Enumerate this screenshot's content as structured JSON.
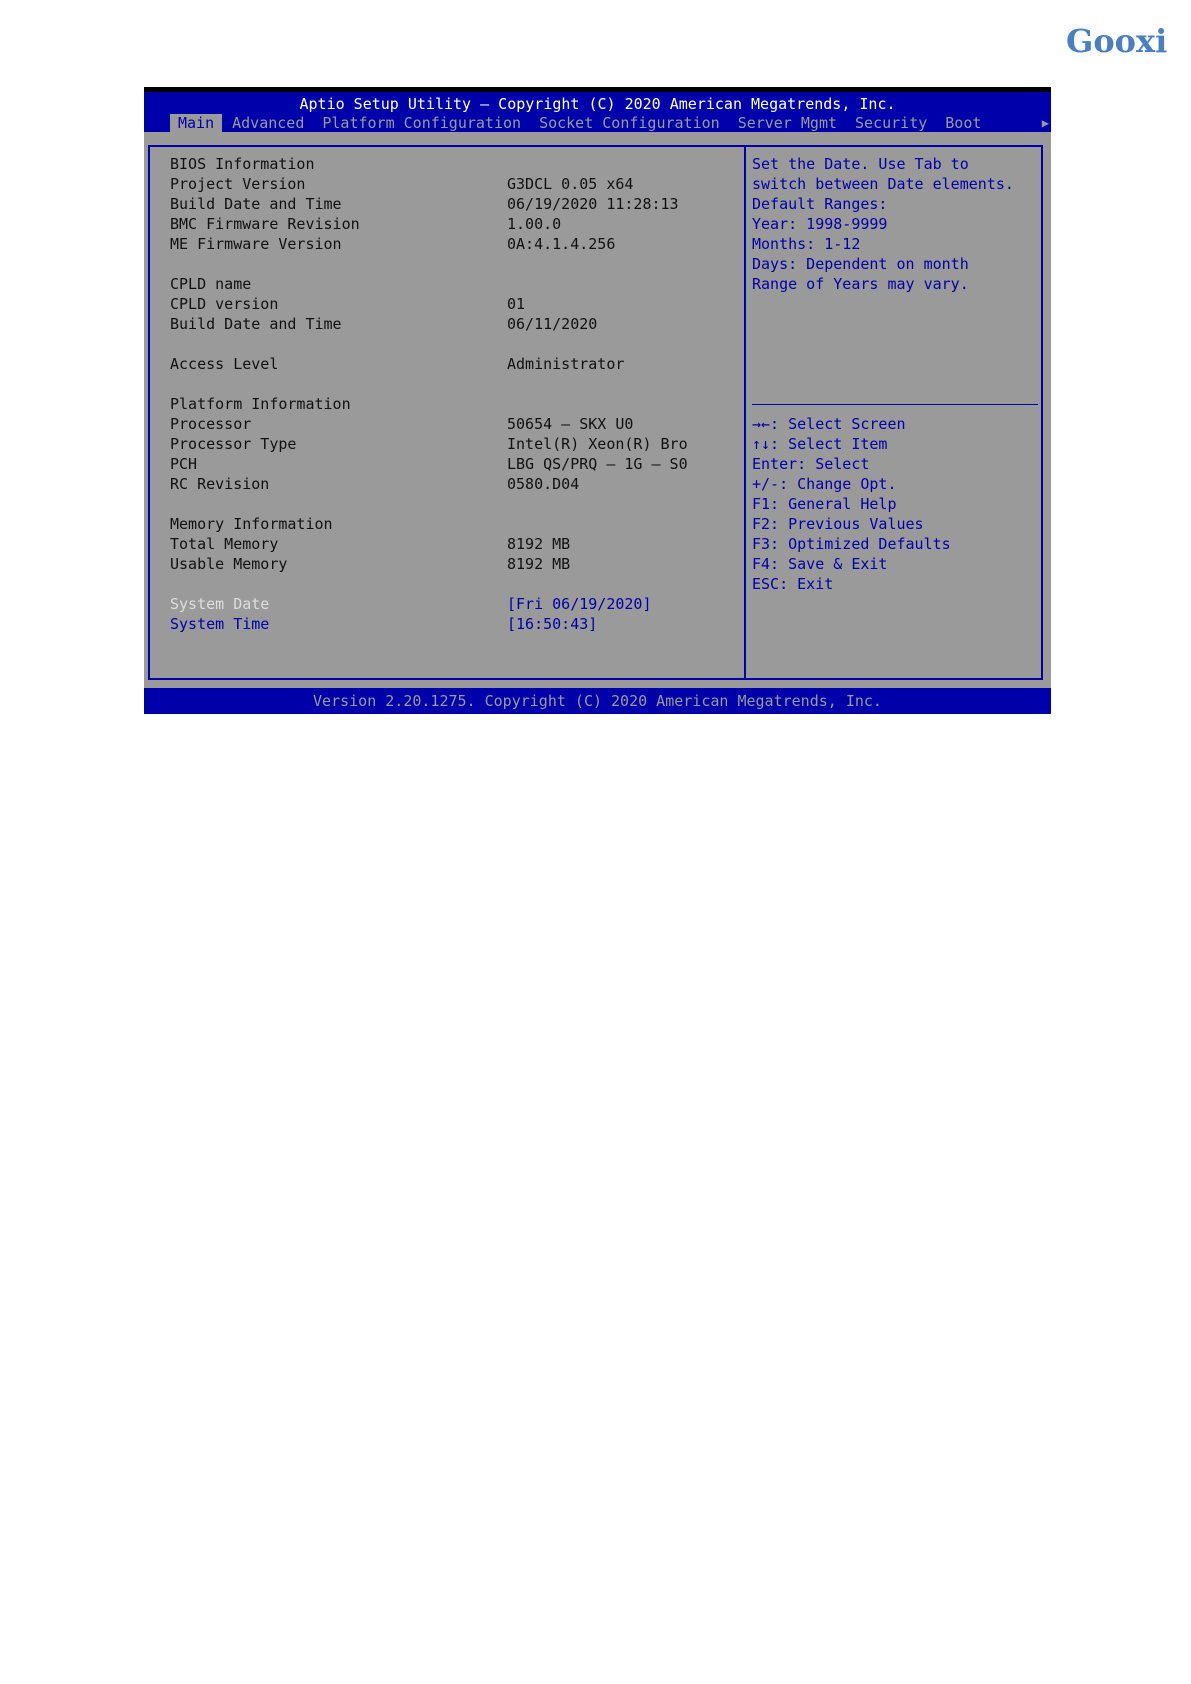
{
  "logo": "Gooxi",
  "title": "Aptio Setup Utility – Copyright (C) 2020 American Megatrends, Inc.",
  "tabs": [
    {
      "label": "Main",
      "active": true
    },
    {
      "label": "Advanced"
    },
    {
      "label": "Platform Configuration"
    },
    {
      "label": "Socket Configuration"
    },
    {
      "label": "Server Mgmt"
    },
    {
      "label": "Security"
    },
    {
      "label": "Boot"
    }
  ],
  "tab_more_icon": "right-arrow-icon",
  "main": {
    "bios_information": "BIOS Information",
    "project_version_label": "Project Version",
    "project_version_value": "G3DCL 0.05 x64",
    "build_date_label": "Build Date and Time",
    "build_date_value": "06/19/2020 11:28:13",
    "bmc_label": "BMC Firmware Revision",
    "bmc_value": "1.00.0",
    "me_label": "ME Firmware Version",
    "me_value": "0A:4.1.4.256",
    "cpld_name_label": "CPLD name",
    "cpld_version_label": "CPLD version",
    "cpld_version_value": "01",
    "cpld_build_label": "Build Date and Time",
    "cpld_build_value": "06/11/2020",
    "access_level_label": "Access Level",
    "access_level_value": "Administrator",
    "platform_information": "Platform Information",
    "processor_label": "Processor",
    "processor_value": "50654 – SKX U0",
    "processor_type_label": "Processor Type",
    "processor_type_value": "Intel(R) Xeon(R) Bro",
    "pch_label": "PCH",
    "pch_value": "LBG QS/PRQ – 1G – S0",
    "rc_label": "RC Revision",
    "rc_value": "0580.D04",
    "memory_information": "Memory Information",
    "total_memory_label": "Total Memory",
    "total_memory_value": "8192 MB",
    "usable_memory_label": "Usable Memory",
    "usable_memory_value": "8192 MB",
    "system_date_label": "System Date",
    "system_date_value": "[Fri 06/19/2020]",
    "system_time_label": "System Time",
    "system_time_value": "[16:50:43]"
  },
  "help": {
    "lines": [
      "Set the Date. Use Tab to",
      "switch between Date elements.",
      "Default Ranges:",
      "Year: 1998-9999",
      "Months: 1-12",
      "Days: Dependent on month",
      "Range of Years may vary."
    ],
    "keys": [
      "→←: Select Screen",
      "↑↓: Select Item",
      "Enter: Select",
      "+/-: Change Opt.",
      "F1: General Help",
      "F2: Previous Values",
      "F3: Optimized Defaults",
      "F4: Save & Exit",
      "ESC: Exit"
    ]
  },
  "footer": "Version 2.20.1275. Copyright (C) 2020 American Megatrends, Inc."
}
